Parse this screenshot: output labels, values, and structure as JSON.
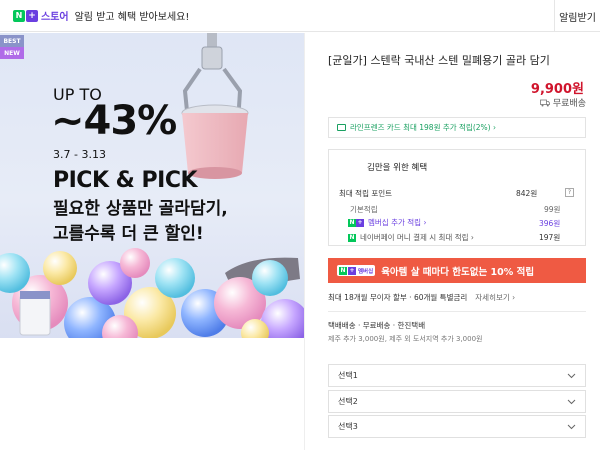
{
  "topbar": {
    "brand_n": "N",
    "brand_plus": "+",
    "store_label": "스토어",
    "notice": "알림 받고 혜택 받아보세요!",
    "alert_button": "알림받기"
  },
  "banner": {
    "tag_best": "BEST",
    "tag_new": "NEW",
    "up_to": "UP TO",
    "discount": "~43%",
    "dates": "3.7 - 3.13",
    "headline": "PICK & PICK",
    "line1": "필요한 상품만 골라담기,",
    "line2": "고를수록 더 큰 할인!"
  },
  "product": {
    "title": "[균일가] 스텐락 국내산 스텐 밀폐용기 골라 담기",
    "price": "9,900원",
    "shipping": "무료배송"
  },
  "card_offer": {
    "text": "라인프렌즈 카드 최대 198원 추가 적립(2%) ›"
  },
  "benefits": {
    "title": "김만을 위한 혜택",
    "max_points_label": "최대 적립 포인트",
    "max_points_value": "842원",
    "help": "?",
    "basic_label": "기본적립",
    "basic_value": "99원",
    "membership_label": "멤버십 추가 적립 ›",
    "membership_value": "396원",
    "naverpay_label": "네이버페이 머니 결제 시 최대 적립 ›",
    "naverpay_value": "197원"
  },
  "promo": {
    "badge_n": "N",
    "badge_plus": "+",
    "badge_text": "멤버십",
    "text": "육아템 살 때마다 한도없는 10% 적립"
  },
  "installment": {
    "text": "최대 18개월 무이자 할부 · 60개월 특별금리",
    "more": "자세히보기 ›"
  },
  "shipping_info": {
    "line1": "택배배송  ·  무료배송  ·  한진택배",
    "line2": "제주 추가 3,000원, 제주 외 도서지역 추가 3,000원"
  },
  "options": [
    {
      "label": "선택1"
    },
    {
      "label": "선택2"
    },
    {
      "label": "선택3"
    }
  ],
  "colors": {
    "accent_red": "#d0142c",
    "naver_green": "#03c75a",
    "plus_purple": "#6a3fe0",
    "promo_bg": "#ef5a43"
  }
}
